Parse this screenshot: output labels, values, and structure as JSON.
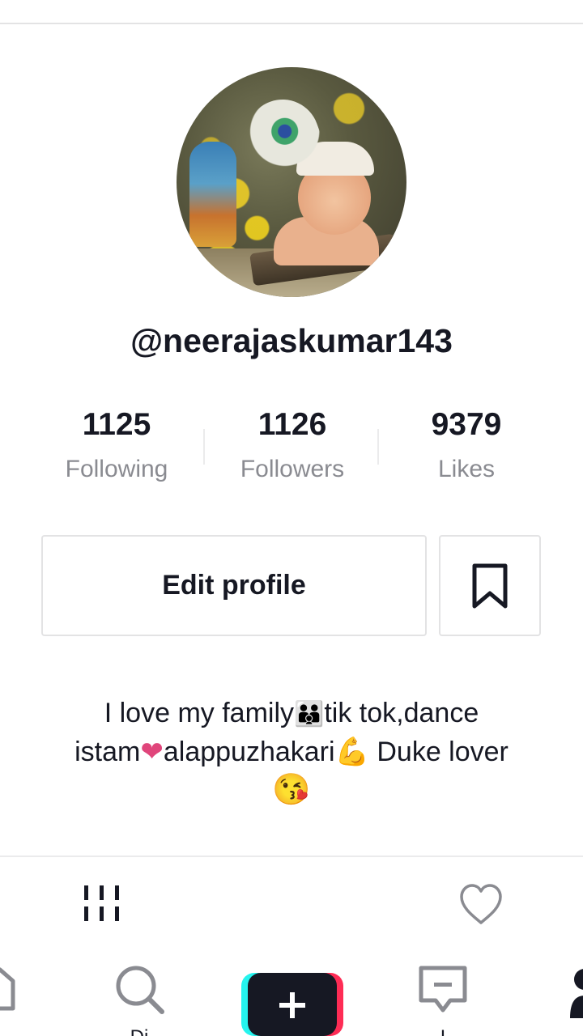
{
  "profile": {
    "username": "@neerajaskumar143",
    "stats": {
      "following": {
        "value": "1125",
        "label": "Following"
      },
      "followers": {
        "value": "1126",
        "label": "Followers"
      },
      "likes": {
        "value": "9379",
        "label": "Likes"
      }
    },
    "edit_button_label": "Edit profile",
    "bio": {
      "line1_text_a": "I love my family",
      "line1_emoji": "👪",
      "line1_text_b": "tik tok,dance",
      "line2_text_a": "istam",
      "line2_emoji_heart": "❤",
      "line2_text_b": "alappuzhakari",
      "line2_emoji_arm": "💪",
      "line2_text_c": " Duke lover",
      "line3_emoji": "😘"
    }
  },
  "bottom_nav": {
    "discover_label": "Di",
    "inbox_label": "I"
  },
  "colors": {
    "text_primary": "#161823",
    "text_secondary": "#8a8b91",
    "border": "#e3e3e4",
    "create_cyan": "#25f4ee",
    "create_red": "#fe2c55"
  },
  "icons": [
    "bookmark-icon",
    "grid-icon",
    "heart-outline-icon",
    "home-icon",
    "search-icon",
    "plus-icon",
    "inbox-icon",
    "me-icon"
  ]
}
